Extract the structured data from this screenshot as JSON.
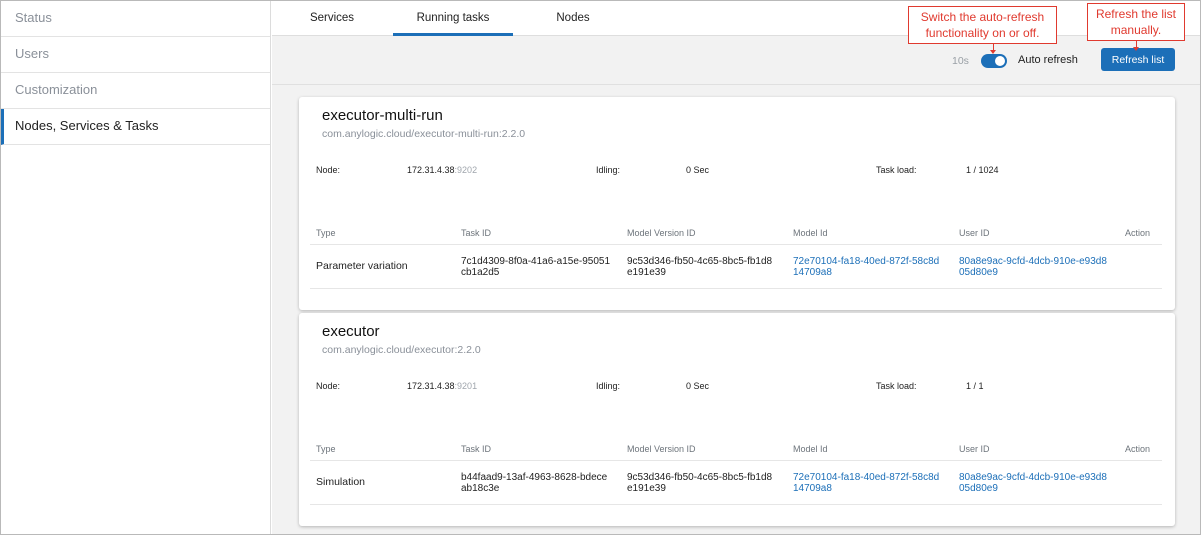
{
  "sidebar": {
    "items": [
      {
        "label": "Status"
      },
      {
        "label": "Users"
      },
      {
        "label": "Customization"
      },
      {
        "label": "Nodes, Services & Tasks"
      }
    ]
  },
  "tabs": [
    {
      "label": "Services"
    },
    {
      "label": "Running tasks"
    },
    {
      "label": "Nodes"
    }
  ],
  "toolbar": {
    "interval": "10s",
    "auto_refresh_label": "Auto refresh",
    "auto_refresh_on": true,
    "refresh_button": "Refresh list"
  },
  "callouts": {
    "toggle": "Switch the auto-refresh functionality on or off.",
    "refresh": "Refresh the list manually."
  },
  "info_labels": {
    "node": "Node:",
    "idling": "Idling:",
    "task_load": "Task load:"
  },
  "table_headers": [
    "Type",
    "Task ID",
    "Model Version ID",
    "Model Id",
    "User ID",
    "Action"
  ],
  "services": [
    {
      "name": "executor-multi-run",
      "image": "com.anylogic.cloud/executor-multi-run:2.2.0",
      "node_ip": "172.31.4.38",
      "node_port": ":9202",
      "idling": "0 Sec",
      "task_load": "1 / 1024",
      "task": {
        "type": "Parameter variation",
        "task_id": "7c1d4309-8f0a-41a6-a15e-95051cb1a2d5",
        "model_version_id": "9c53d346-fb50-4c65-8bc5-fb1d8e191e39",
        "model_id": "72e70104-fa18-40ed-872f-58c8d14709a8",
        "user_id": "80a8e9ac-9cfd-4dcb-910e-e93d805d80e9"
      }
    },
    {
      "name": "executor",
      "image": "com.anylogic.cloud/executor:2.2.0",
      "node_ip": "172.31.4.38",
      "node_port": ":9201",
      "idling": "0 Sec",
      "task_load": "1 / 1",
      "task": {
        "type": "Simulation",
        "task_id": "b44faad9-13af-4963-8628-bdeceab18c3e",
        "model_version_id": "9c53d346-fb50-4c65-8bc5-fb1d8e191e39",
        "model_id": "72e70104-fa18-40ed-872f-58c8d14709a8",
        "user_id": "80a8e9ac-9cfd-4dcb-910e-e93d805d80e9"
      }
    }
  ],
  "colors": {
    "accent": "#1c6fb8",
    "callout": "#e03a2f"
  }
}
